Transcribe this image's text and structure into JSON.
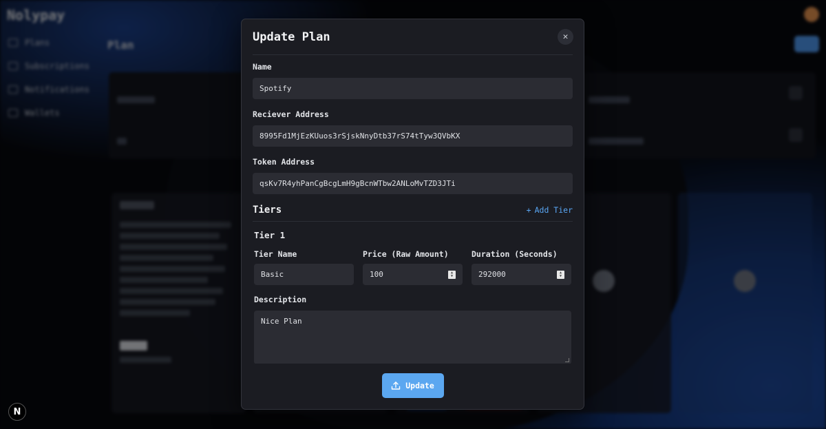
{
  "background": {
    "brand": "Nolypay",
    "page_title": "Plan",
    "sidebar": [
      {
        "label": "Plans",
        "icon": "grid-icon"
      },
      {
        "label": "Subscriptions",
        "icon": "list-icon"
      },
      {
        "label": "Notifications",
        "icon": "bell-icon"
      },
      {
        "label": "Wallets",
        "icon": "wallet-icon"
      }
    ]
  },
  "modal": {
    "title": "Update Plan",
    "close_icon": "close-icon",
    "fields": {
      "name_label": "Name",
      "name_value": "Spotify",
      "receiver_label": "Reciever Address",
      "receiver_value": "8995Fd1MjEzKUuos3rSjskNnyDtb37rS74tTyw3QVbKX",
      "token_label": "Token Address",
      "token_value": "qsKv7R4yhPanCgBcgLmH9gBcnWTbw2ANLoMvTZD3JTi"
    },
    "tiers": {
      "title": "Tiers",
      "add_label": "Add Tier",
      "items": [
        {
          "heading": "Tier 1",
          "name_label": "Tier Name",
          "name_value": "Basic",
          "price_label": "Price (Raw Amount)",
          "price_value": "100",
          "duration_label": "Duration (Seconds)",
          "duration_value": "292000",
          "description_label": "Description",
          "description_value": "Nice Plan"
        }
      ]
    },
    "submit_label": "Update"
  },
  "colors": {
    "accent": "#5ba7f0",
    "modal_bg": "#1b1c22",
    "input_bg": "#2b2c33"
  }
}
